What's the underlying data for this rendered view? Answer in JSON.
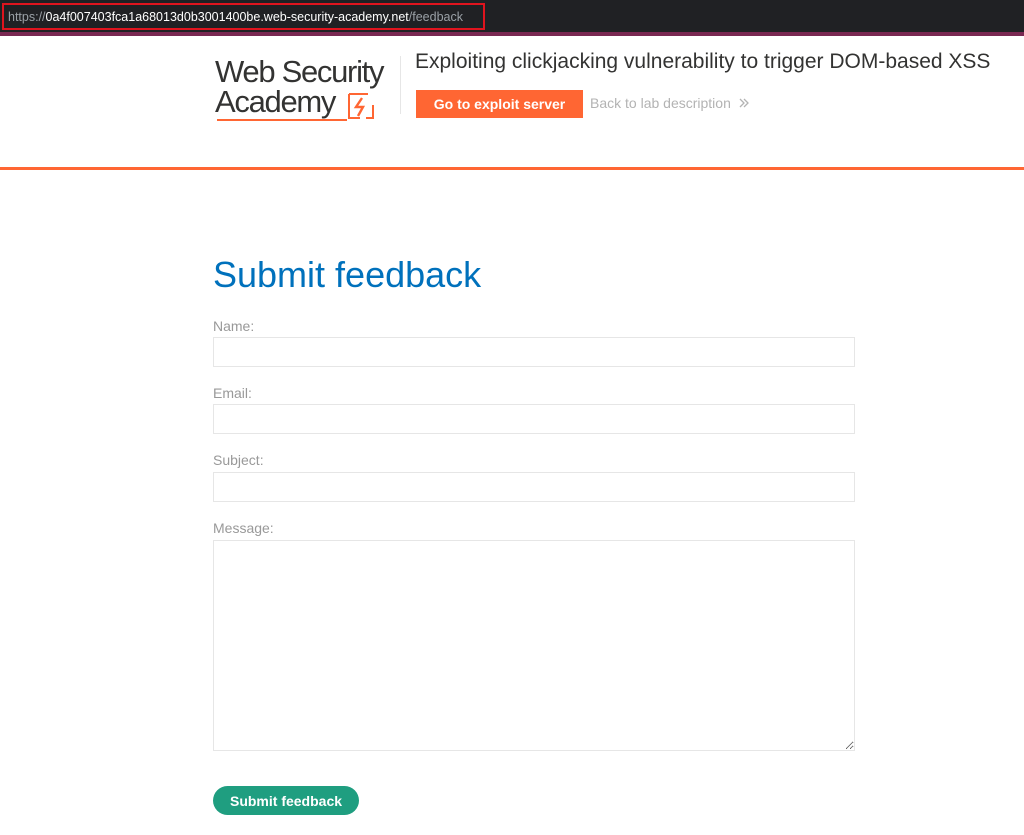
{
  "browser": {
    "url_scheme": "https://",
    "url_host": "0a4f007403fca1a68013d0b3001400be.web-security-academy.net",
    "url_path": "/feedback"
  },
  "header": {
    "logo_line1": "Web Security",
    "logo_line2": "Academy",
    "lab_title": "Exploiting clickjacking vulnerability to trigger DOM-based XSS",
    "exploit_button": "Go to exploit server",
    "back_link": "Back to lab description",
    "accent_color": "#ff6633"
  },
  "form": {
    "title": "Submit feedback",
    "name_label": "Name:",
    "name_value": "",
    "email_label": "Email:",
    "email_value": "",
    "subject_label": "Subject:",
    "subject_value": "",
    "message_label": "Message:",
    "message_value": "",
    "submit_label": "Submit feedback",
    "submit_color": "#1f9e80",
    "title_color": "#0071bc"
  },
  "icons": {
    "logo": "lightning-bolt-icon",
    "back": "chevron-double-right-icon",
    "resize": "resize-grip-icon"
  }
}
